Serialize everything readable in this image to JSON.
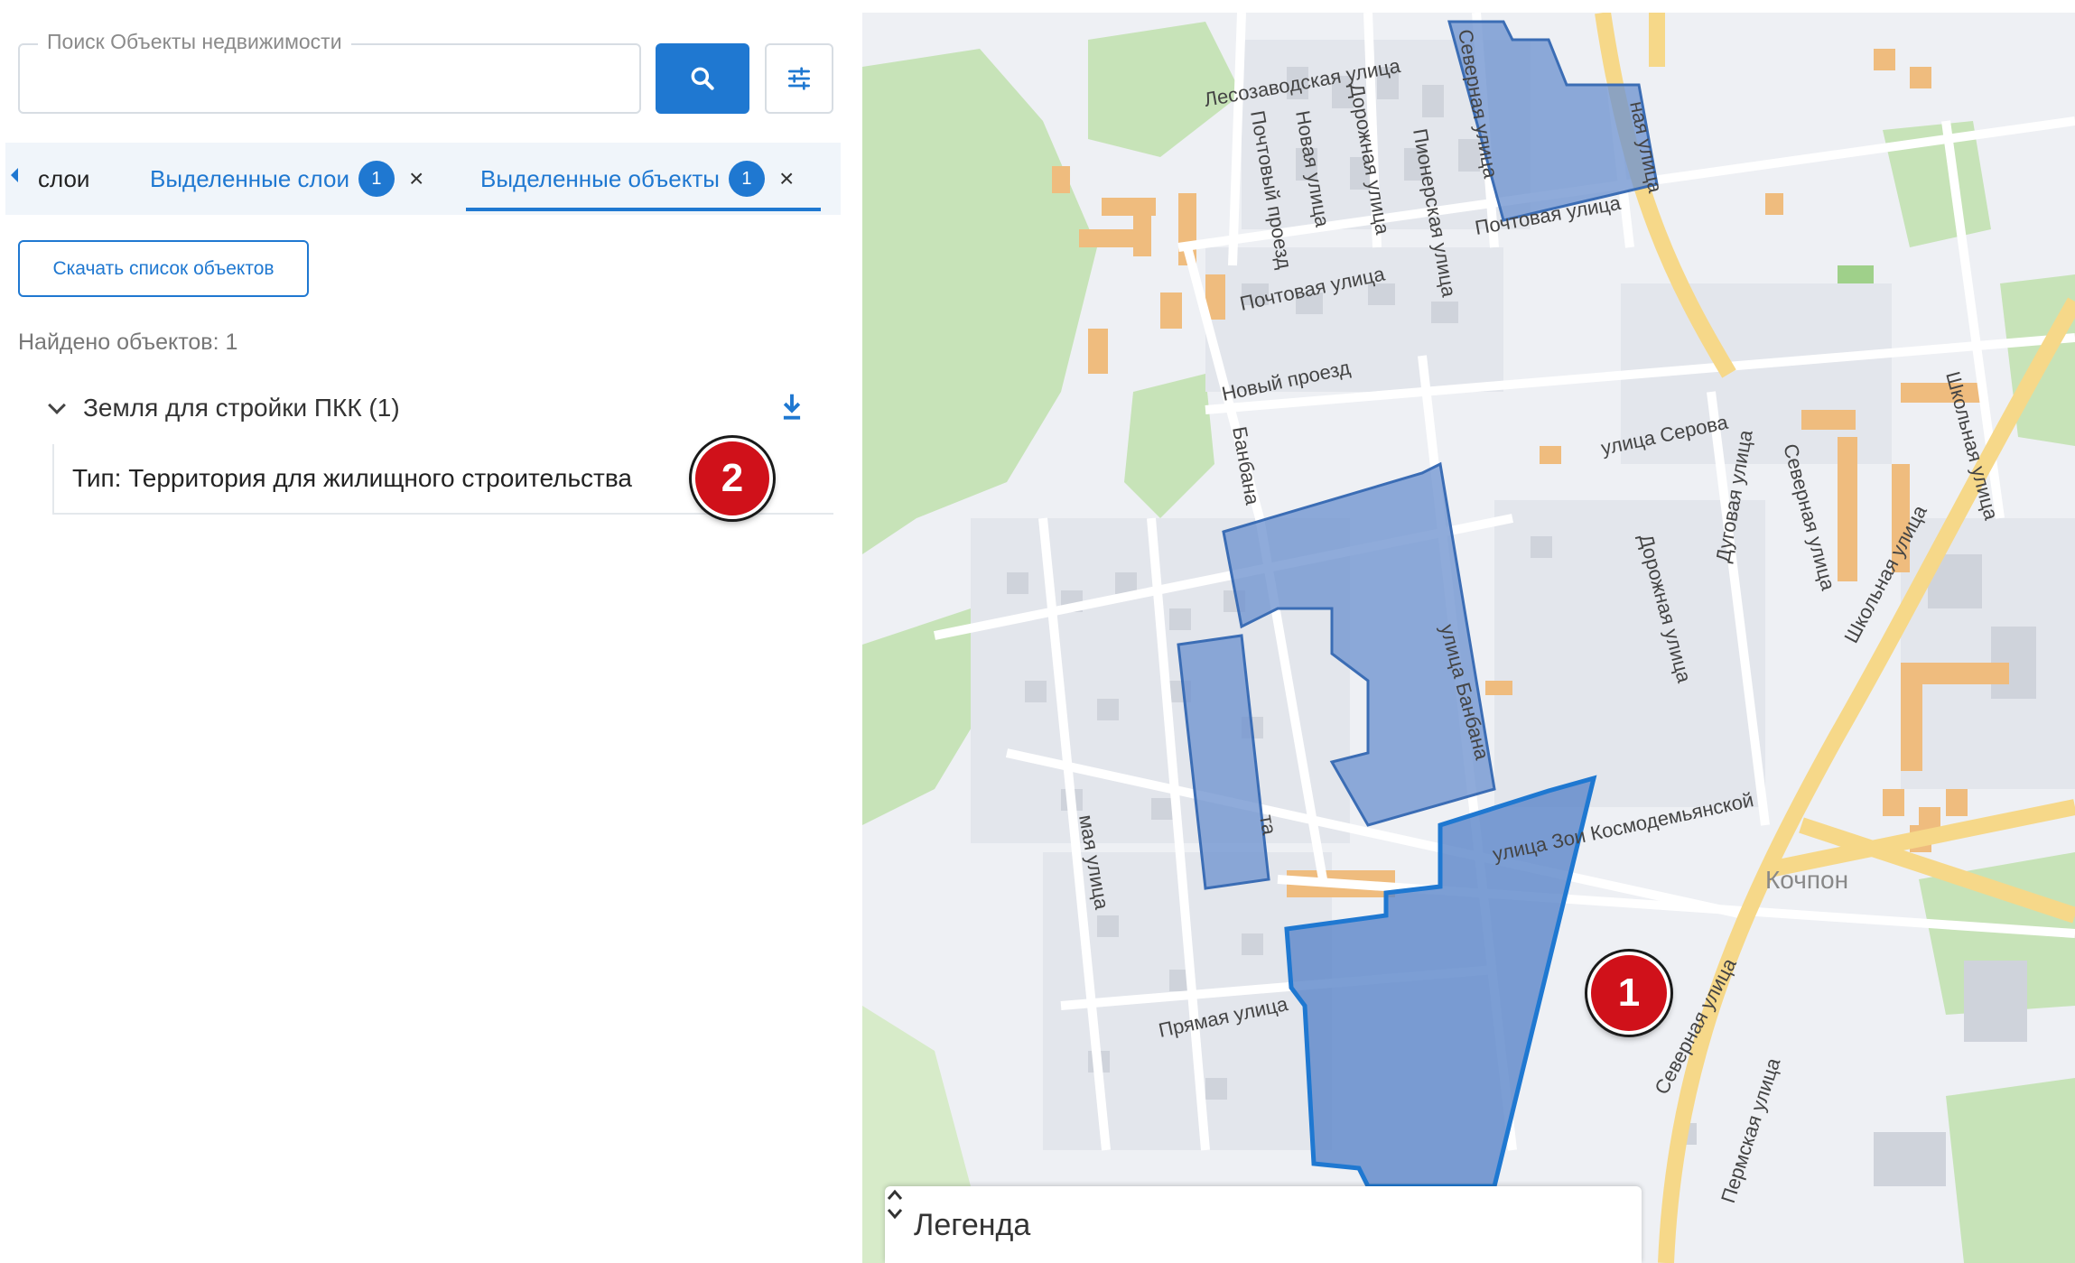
{
  "search": {
    "label": "Поиск Объекты недвижимости",
    "value": ""
  },
  "tabs": {
    "layers_label": "слои",
    "selected_layers_label": "Выделенные слои",
    "selected_layers_count": "1",
    "selected_objects_label": "Выделенные объекты",
    "selected_objects_count": "1",
    "close_glyph": "×"
  },
  "actions": {
    "download_list_label": "Скачать список объектов"
  },
  "results": {
    "found_text": "Найдено объектов: 1",
    "group_title": "Земля для стройки ПКК (1)",
    "item_text": "Тип: Территория для жилищного строительства"
  },
  "markers": {
    "marker_1": "1",
    "marker_2": "2"
  },
  "map": {
    "streets": [
      "Лесозаводская улица",
      "Почтовый проезд",
      "Новая улица",
      "Дорожная улица",
      "Пионерская улица",
      "Северная улица",
      "Почтовая улица",
      "Почтовая улица",
      "Новый проезд",
      "улица Серова",
      "Банбана",
      "Дорожная улица",
      "Дуговая улица",
      "Северная улица",
      "Школьная улица",
      "Школьная улица",
      "улица Банбана",
      "улица Зои Космодемьянской",
      "Кочпон",
      "Северная улица",
      "Пермская улица",
      "Прямая улица",
      "мая улица",
      "та",
      "ная улица"
    ],
    "colors": {
      "selection_fill": "#6f94cf",
      "selection_stroke": "#1f78d1",
      "road_major": "#f6d889",
      "green": "#c7e3b8",
      "building": "#cfd3db",
      "building_orange": "#efbc7e"
    }
  },
  "legend": {
    "title": "Легенда"
  },
  "icons": [
    "search-icon",
    "filter-icon",
    "chevron-left-icon",
    "close-icon",
    "chevron-down-icon",
    "download-icon",
    "sort-toggle-icon"
  ]
}
